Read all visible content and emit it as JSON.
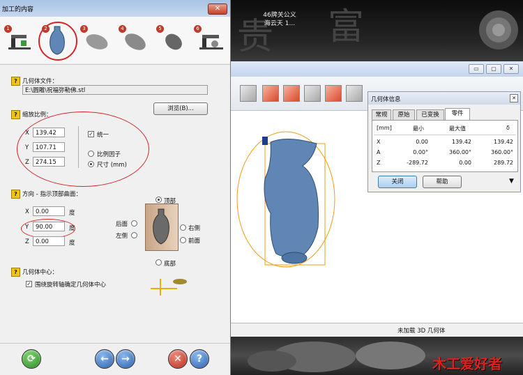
{
  "dialog": {
    "title": "加工的内容",
    "steps": [
      "1",
      "2",
      "3",
      "4",
      "5",
      "6"
    ],
    "geometry_file": {
      "label": "几何体文件：",
      "path": "E:\\圆雕\\祝福弥勒佛.stl",
      "browse_label": "浏览(B)..."
    },
    "scale": {
      "label": "缩放比例：",
      "x_label": "X",
      "x_value": "139.42",
      "y_label": "Y",
      "y_value": "107.71",
      "z_label": "Z",
      "z_value": "274.15",
      "uniform_label": "统一",
      "factor_label": "比例因子",
      "size_label": "尺寸 (mm)"
    },
    "orientation": {
      "label": "方向 - 指示顶部曲面：",
      "x_label": "X",
      "x_value": "0.00",
      "y_label": "Y",
      "y_value": "90.00",
      "z_label": "Z",
      "z_value": "0.00",
      "unit": "度",
      "top": "顶部",
      "bottom": "底部",
      "back": "后面",
      "front": "前面",
      "left": "左侧",
      "right": "右侧"
    },
    "center": {
      "label": "几何体中心：",
      "rotate_axis_label": "围绕旋转轴确定几何体中心"
    },
    "help_mark": "?"
  },
  "desktop": {
    "icon_label_1": "46牌关公义",
    "icon_label_2": "海云天 1...",
    "watermark": "木工爱好者",
    "big_glyph_1": "贵",
    "big_glyph_2": "富"
  },
  "app": {
    "status_text": "未加载 3D 几何体",
    "min_glyph": "▭",
    "max_glyph": "▢",
    "close_glyph": "✕"
  },
  "info_panel": {
    "title": "几何体信息",
    "tabs": [
      "常规",
      "原始",
      "已变换",
      "零件"
    ],
    "columns": [
      "[mm]",
      "最小",
      "最大值",
      "δ"
    ],
    "rows": [
      {
        "axis": "X",
        "min": "0.00",
        "max": "139.42",
        "delta": "139.42"
      },
      {
        "axis": "A",
        "min": "0.00°",
        "max": "360.00°",
        "delta": "360.00°"
      },
      {
        "axis": "Z",
        "min": "-289.72",
        "max": "0.00",
        "delta": "289.72"
      }
    ],
    "close_label": "关闭",
    "help_label": "帮助"
  },
  "colors": {
    "accent_red": "#d6262a",
    "vase_blue": "#5f86b5",
    "bbox_orange": "#f39c12"
  }
}
